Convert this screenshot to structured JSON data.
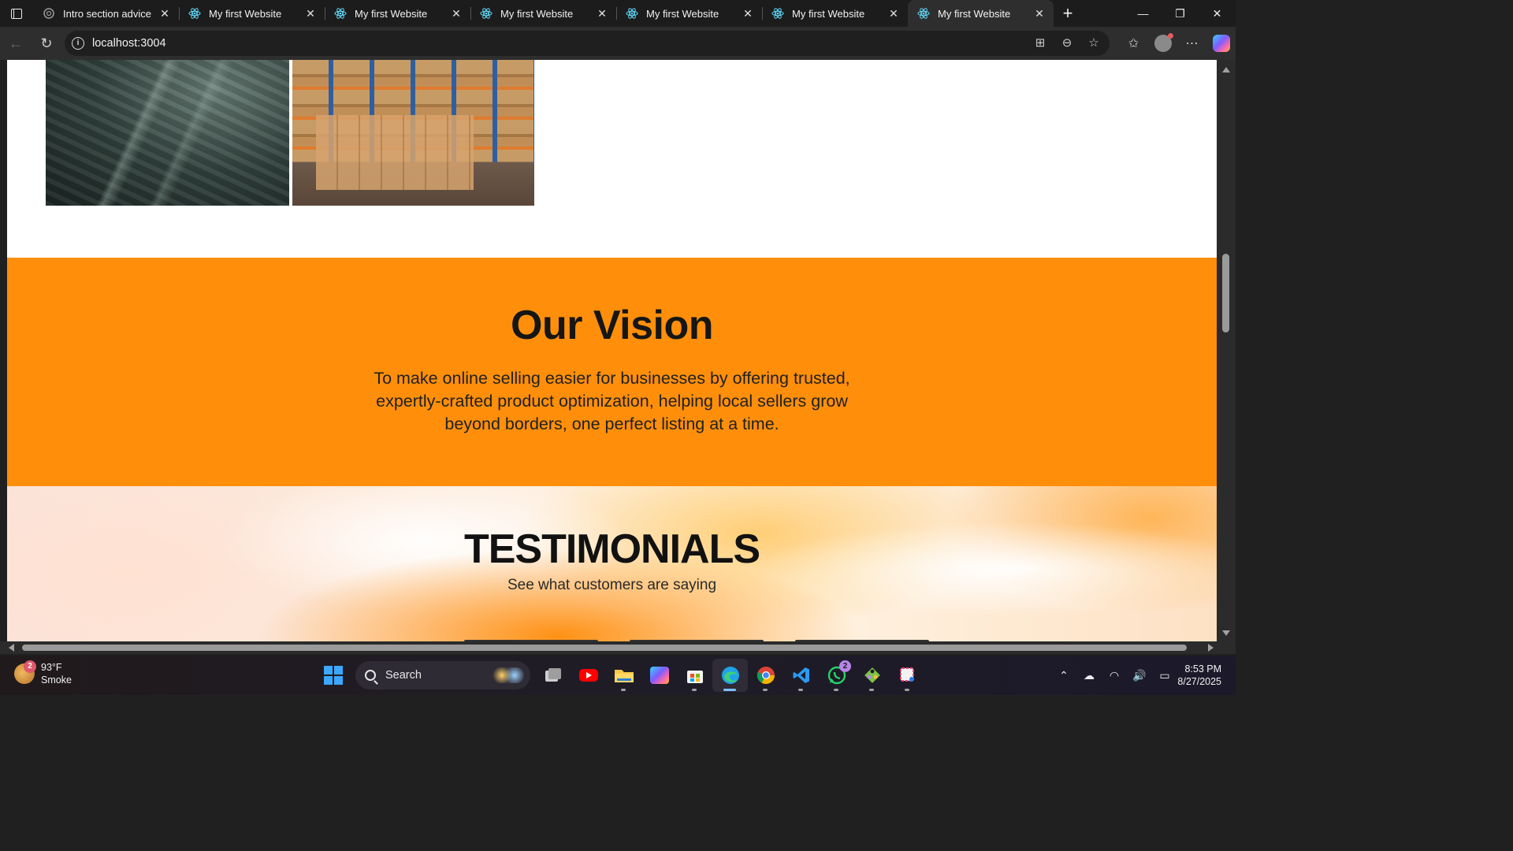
{
  "browser": {
    "tabs": [
      {
        "title": "Intro section advice",
        "favicon": "openai-icon",
        "active": false
      },
      {
        "title": "My first Website",
        "favicon": "react-icon",
        "active": false
      },
      {
        "title": "My first Website",
        "favicon": "react-icon",
        "active": false
      },
      {
        "title": "My first Website",
        "favicon": "react-icon",
        "active": false
      },
      {
        "title": "My first Website",
        "favicon": "react-icon",
        "active": false
      },
      {
        "title": "My first Website",
        "favicon": "react-icon",
        "active": false
      },
      {
        "title": "My first Website",
        "favicon": "react-icon",
        "active": true
      }
    ],
    "url": "localhost:3004",
    "tab_close_glyph": "✕",
    "new_tab_glyph": "+"
  },
  "page": {
    "vision": {
      "heading": "Our Vision",
      "body": "To make online selling easier for businesses by offering trusted, expertly-crafted product optimization, helping local sellers grow beyond borders, one perfect listing at a time."
    },
    "testimonials": {
      "heading": "TESTIMONIALS",
      "subheading": "See what customers are saying"
    },
    "images": [
      "factory-conveyor-image",
      "warehouse-boxes-image"
    ]
  },
  "colors": {
    "vision_bg": "#ff8f0b",
    "heading_text": "#161616"
  },
  "taskbar": {
    "weather": {
      "temp": "93°F",
      "condition": "Smoke",
      "badge": "2"
    },
    "search_label": "Search",
    "whatsapp_badge": "2",
    "time": "8:53 PM",
    "date": "8/27/2025"
  }
}
